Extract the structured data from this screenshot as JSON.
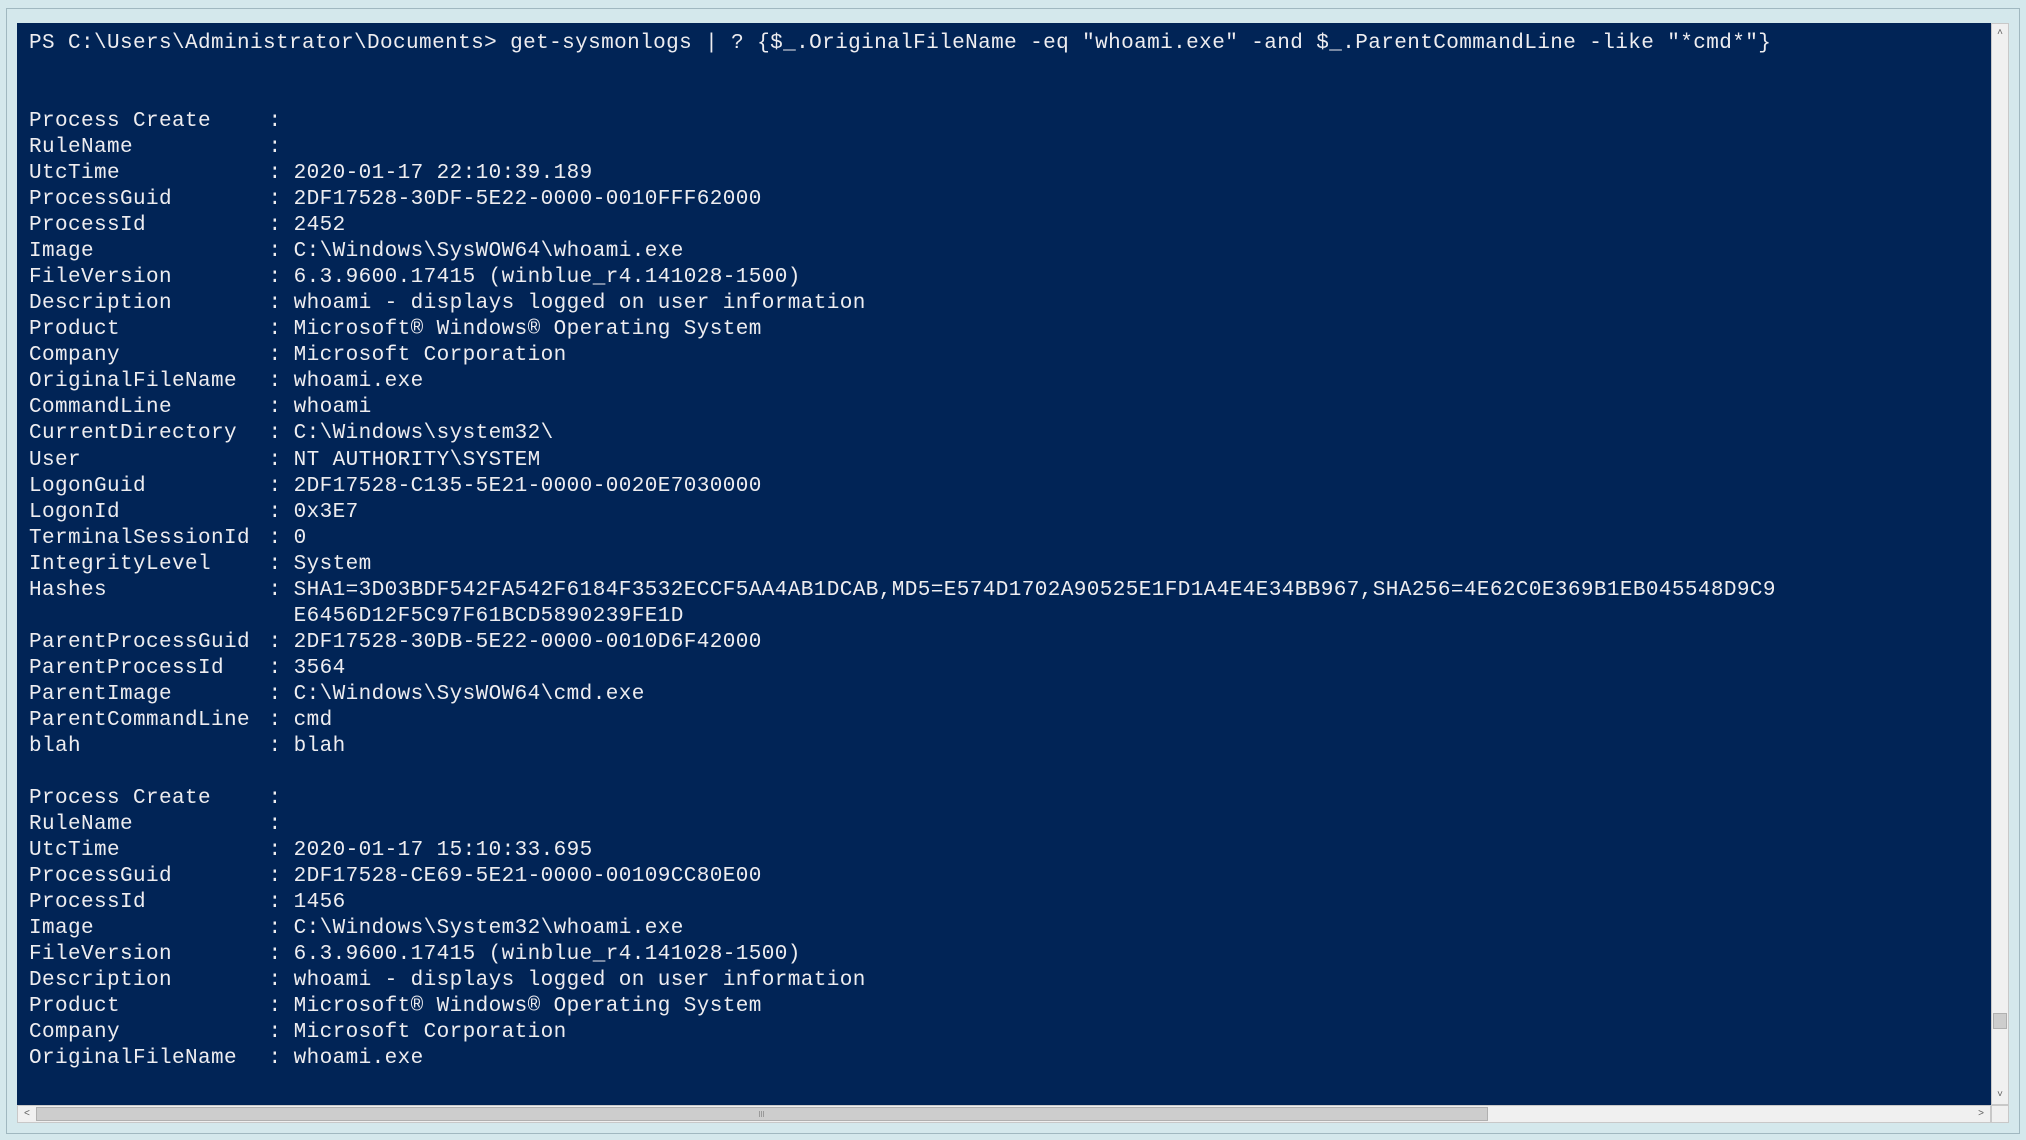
{
  "prompt_prefix": "PS C:\\Users\\Administrator\\Documents> ",
  "command": "get-sysmonlogs | ? {$_.OriginalFileName -eq \"whoami.exe\" -and $_.ParentCommandLine -like \"*cmd*\"}",
  "records": [
    {
      "header": "Process Create",
      "fields": [
        {
          "k": "RuleName",
          "v": ""
        },
        {
          "k": "UtcTime",
          "v": "2020-01-17 22:10:39.189"
        },
        {
          "k": "ProcessGuid",
          "v": "2DF17528-30DF-5E22-0000-0010FFF62000"
        },
        {
          "k": "ProcessId",
          "v": "2452"
        },
        {
          "k": "Image",
          "v": "C:\\Windows\\SysWOW64\\whoami.exe"
        },
        {
          "k": "FileVersion",
          "v": "6.3.9600.17415 (winblue_r4.141028-1500)"
        },
        {
          "k": "Description",
          "v": "whoami - displays logged on user information"
        },
        {
          "k": "Product",
          "v": "Microsoft® Windows® Operating System"
        },
        {
          "k": "Company",
          "v": "Microsoft Corporation"
        },
        {
          "k": "OriginalFileName",
          "v": "whoami.exe"
        },
        {
          "k": "CommandLine",
          "v": "whoami"
        },
        {
          "k": "CurrentDirectory",
          "v": "C:\\Windows\\system32\\"
        },
        {
          "k": "User",
          "v": "NT AUTHORITY\\SYSTEM"
        },
        {
          "k": "LogonGuid",
          "v": "2DF17528-C135-5E21-0000-0020E7030000"
        },
        {
          "k": "LogonId",
          "v": "0x3E7"
        },
        {
          "k": "TerminalSessionId",
          "v": "0"
        },
        {
          "k": "IntegrityLevel",
          "v": "System"
        },
        {
          "k": "Hashes",
          "v": "SHA1=3D03BDF542FA542F6184F3532ECCF5AA4AB1DCAB,MD5=E574D1702A90525E1FD1A4E4E34BB967,SHA256=4E62C0E369B1EB045548D9C9",
          "wrap": "E6456D12F5C97F61BCD5890239FE1D"
        },
        {
          "k": "ParentProcessGuid",
          "v": "2DF17528-30DB-5E22-0000-0010D6F42000"
        },
        {
          "k": "ParentProcessId",
          "v": "3564"
        },
        {
          "k": "ParentImage",
          "v": "C:\\Windows\\SysWOW64\\cmd.exe"
        },
        {
          "k": "ParentCommandLine",
          "v": "cmd"
        },
        {
          "k": "blah",
          "v": "blah"
        }
      ]
    },
    {
      "header": "Process Create",
      "fields": [
        {
          "k": "RuleName",
          "v": ""
        },
        {
          "k": "UtcTime",
          "v": "2020-01-17 15:10:33.695"
        },
        {
          "k": "ProcessGuid",
          "v": "2DF17528-CE69-5E21-0000-00109CC80E00"
        },
        {
          "k": "ProcessId",
          "v": "1456"
        },
        {
          "k": "Image",
          "v": "C:\\Windows\\System32\\whoami.exe"
        },
        {
          "k": "FileVersion",
          "v": "6.3.9600.17415 (winblue_r4.141028-1500)"
        },
        {
          "k": "Description",
          "v": "whoami - displays logged on user information"
        },
        {
          "k": "Product",
          "v": "Microsoft® Windows® Operating System"
        },
        {
          "k": "Company",
          "v": "Microsoft Corporation"
        },
        {
          "k": "OriginalFileName",
          "v": "whoami.exe"
        }
      ]
    }
  ],
  "scroll_glyphs": {
    "up": "˄",
    "down": "˅",
    "left": "˂",
    "right": "˃"
  }
}
